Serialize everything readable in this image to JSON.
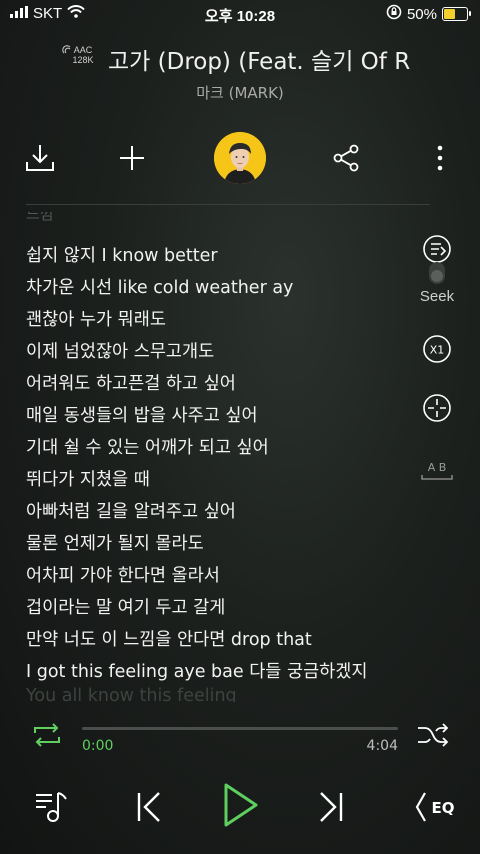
{
  "status": {
    "carrier": "SKT",
    "time": "오후 10:28",
    "battery": "50%",
    "battery_level": 0.5
  },
  "header": {
    "codec_line1": "AAC",
    "codec_line2": "128K",
    "title": "고가 (Drop) (Feat. 슬기 Of R",
    "artist": "마크 (MARK)"
  },
  "lyrics": {
    "lines": [
      "쉽지 않지 I know better",
      "차가운 시선 like cold weather ay",
      "괜찮아 누가 뭐래도",
      "이제 넘었잖아 스무고개도",
      "어려워도 하고픈걸 하고 싶어",
      "매일 동생들의 밥을 사주고 싶어",
      "기대 쉴 수 있는 어깨가 되고 싶어",
      "뛰다가 지쳤을 때",
      "아빠처럼 길을 알려주고 싶어",
      "물론 언제가 될지 몰라도",
      "어차피 가야 한다면 올라서",
      "겁이라는 말 여기 두고 갈게",
      "만약 너도 이 느낌을 안다면 drop that",
      "I got this feeling aye bae 다들 궁금하겠지"
    ],
    "partial_top": "느낌",
    "partial_bottom": "You all know this feeling"
  },
  "side": {
    "seek_label": "Seek",
    "speed_label": "X1",
    "ab_label": "A B"
  },
  "player": {
    "current_time": "0:00",
    "total_time": "4:04",
    "progress": 0.0,
    "eq_label": "EQ"
  },
  "colors": {
    "accent": "#5fcf5f",
    "background": "#1c201d",
    "avatar_bg": "#f5c518"
  }
}
